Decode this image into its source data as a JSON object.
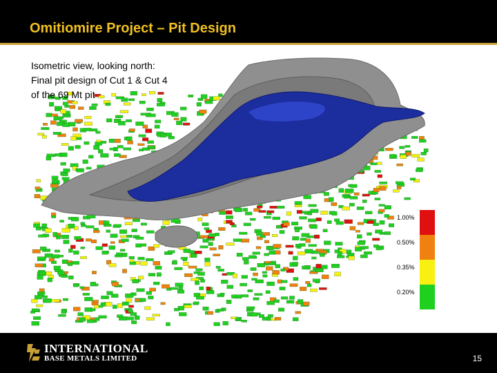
{
  "slide": {
    "title": "Omitiomire Project – Pit Design",
    "caption": [
      "Isometric view, looking north:",
      "Final pit design of Cut 1 & Cut 4",
      "of the 69 Mt pit"
    ],
    "page_number": "15"
  },
  "legend": {
    "items": [
      {
        "label": "1.00%",
        "color": "#e01010"
      },
      {
        "label": "0.50%",
        "color": "#f08010"
      },
      {
        "label": "0.35%",
        "color": "#f8f010"
      },
      {
        "label": "0.20%",
        "color": "#20d020"
      }
    ]
  },
  "footer": {
    "company_line1": "INTERNATIONAL",
    "company_line2": "BASE METALS LIMITED"
  },
  "colors": {
    "title_text": "#f0c020",
    "header_bg": "#000000",
    "accent_rule": "#c8a038",
    "pit_shell": "#8a8a8a",
    "orebody": "#1a2fa0"
  }
}
